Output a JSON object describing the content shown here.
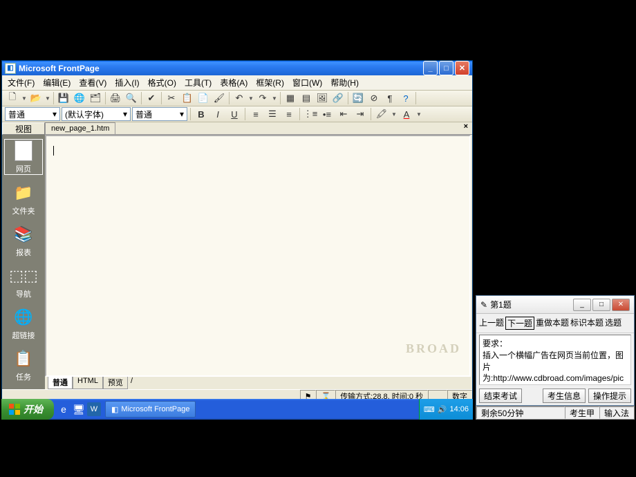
{
  "frontpage": {
    "title": "Microsoft FrontPage",
    "menus": [
      "文件(F)",
      "编辑(E)",
      "查看(V)",
      "插入(I)",
      "格式(O)",
      "工具(T)",
      "表格(A)",
      "框架(R)",
      "窗口(W)",
      "帮助(H)"
    ],
    "combo_style": "普通",
    "combo_font": "(默认字体)",
    "combo_size": "普通",
    "sidebar_header": "视图",
    "sidebar_items": [
      {
        "label": "网页",
        "icon": "📄"
      },
      {
        "label": "文件夹",
        "icon": "📁"
      },
      {
        "label": "报表",
        "icon": "📚"
      },
      {
        "label": "导航",
        "icon": "🧭"
      },
      {
        "label": "超链接",
        "icon": "🔗"
      },
      {
        "label": "任务",
        "icon": "📋"
      }
    ],
    "doc_tab": "new_page_1.htm",
    "view_tabs": [
      "普通",
      "HTML",
      "预览"
    ],
    "status_transfer": "传输方式:28.8, 时间:0 秒",
    "status_right": "数字"
  },
  "exam": {
    "title": "第1题",
    "nav": {
      "prev": "上一题",
      "next": "下一题",
      "redo": "重做本题",
      "mark": "标识本题",
      "select": "选题"
    },
    "body_l1": "要求：",
    "body_l2": "插入一个横幅广告在网页当前位置，图片为:http://www.cdbroad.com/images/pic main.gif,链接到:",
    "btn_end": "结束考试",
    "btn_info": "考生信息",
    "btn_hint": "操作提示",
    "remaining": "剩余50分钟",
    "candidate": "考生甲",
    "ime": "输入法"
  },
  "taskbar": {
    "start": "开始",
    "task1": "Microsoft FrontPage",
    "clock": "14:06"
  }
}
